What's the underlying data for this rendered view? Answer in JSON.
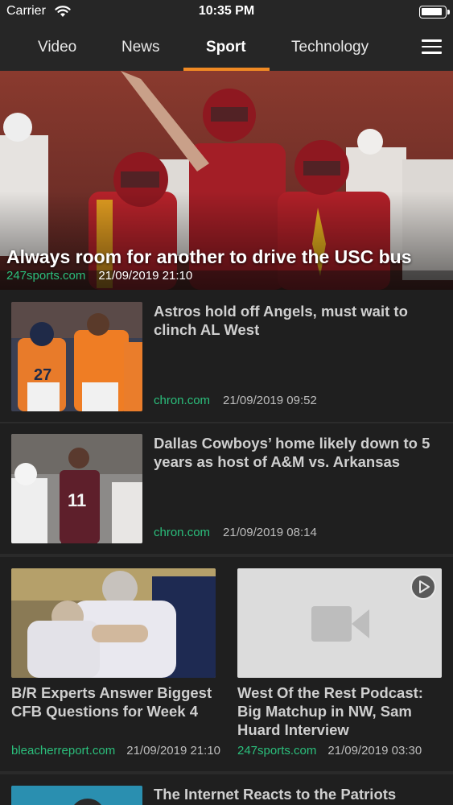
{
  "status_bar": {
    "carrier": "Carrier",
    "time": "10:35 PM"
  },
  "tabs": [
    {
      "label": "Video"
    },
    {
      "label": "News"
    },
    {
      "label": "Sport",
      "active": true
    },
    {
      "label": "Technology"
    }
  ],
  "accent_color": "#f08a24",
  "source_color": "#2bbf7c",
  "hero": {
    "title": "Always room for another to drive the USC bus",
    "source": "247sports.com",
    "date": "21/09/2019 21:10"
  },
  "articles": [
    {
      "title": "Astros hold off Angels, must wait to clinch AL West",
      "source": "chron.com",
      "date": "21/09/2019 09:52"
    },
    {
      "title": "Dallas Cowboys’ home likely down to 5 years as host of A&M vs. Arkansas",
      "source": "chron.com",
      "date": "21/09/2019 08:14"
    }
  ],
  "cards": [
    {
      "title": "B/R Experts Answer Biggest CFB Questions for Week 4",
      "source": "bleacherreport.com",
      "date": "21/09/2019 21:10"
    },
    {
      "title": "West Of the Rest Podcast: Big Matchup in NW, Sam Huard Interview",
      "source": "247sports.com",
      "date": "21/09/2019 03:30",
      "icons": [
        "play-icon",
        "video-camera-icon"
      ]
    }
  ],
  "partial_article": {
    "title": "The Internet Reacts to the Patriots"
  }
}
